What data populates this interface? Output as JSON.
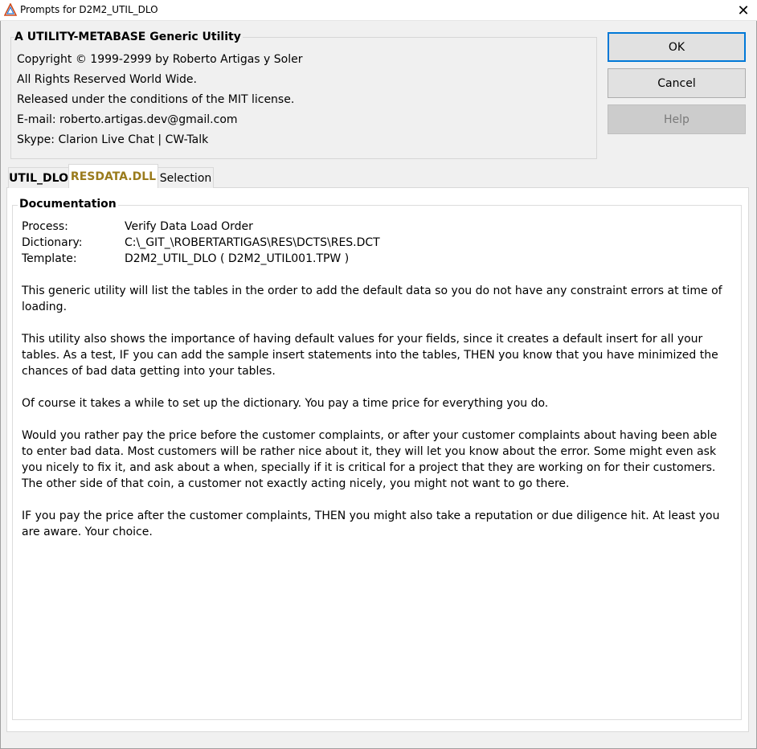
{
  "window": {
    "title": "Prompts for D2M2_UTIL_DLO",
    "close_glyph": "✕"
  },
  "header": {
    "title": "A UTILITY-METABASE Generic Utility",
    "lines": [
      "Copyright © 1999-2999 by Roberto Artigas y Soler",
      "All Rights Reserved World Wide.",
      "Released under the conditions of the MIT license.",
      "E-mail: roberto.artigas.dev@gmail.com",
      "Skype: Clarion Live Chat | CW-Talk"
    ]
  },
  "buttons": {
    "ok": "OK",
    "cancel": "Cancel",
    "help": "Help"
  },
  "tabs": [
    {
      "label": "UTIL_DLO",
      "selected": false
    },
    {
      "label": "RESDATA.DLL",
      "selected": true
    },
    {
      "label": "Selection",
      "selected": false
    }
  ],
  "documentation": {
    "title": "Documentation",
    "fields": [
      {
        "label": "Process:",
        "value": "Verify Data Load Order"
      },
      {
        "label": "Dictionary:",
        "value": "C:\\_GIT_\\ROBERTARTIGAS\\RES\\DCTS\\RES.DCT"
      },
      {
        "label": "Template:",
        "value": "D2M2_UTIL_DLO ( D2M2_UTIL001.TPW )"
      }
    ],
    "paragraphs": [
      "This generic utility will list the tables in the order to add the default data so you do not have any constraint errors at time of loading.",
      "This utility also shows the importance of having default values for your fields, since it creates a default insert for all your tables. As a test, IF you can add the sample insert statements into the tables, THEN you know that you have minimized the chances of bad data getting into your tables.",
      "Of course it takes a while to set up the dictionary. You pay a time price for everything you do.",
      "Would you rather pay the price before the customer complaints, or after your customer complaints about having been able to enter bad data. Most customers will be rather nice about it, they will let you know about the error. Some might even ask you nicely to fix it, and ask about a when, specially if it is critical for a project that they are working on for their customers. The other side of that coin, a customer not exactly acting nicely, you might not want to go there.",
      "IF you pay the price after the customer complaints, THEN you might also take a reputation or due diligence hit. At least you are aware. Your choice."
    ]
  },
  "colors": {
    "selected_tab_text": "#9a7b1c",
    "ok_border": "#0078d7"
  }
}
